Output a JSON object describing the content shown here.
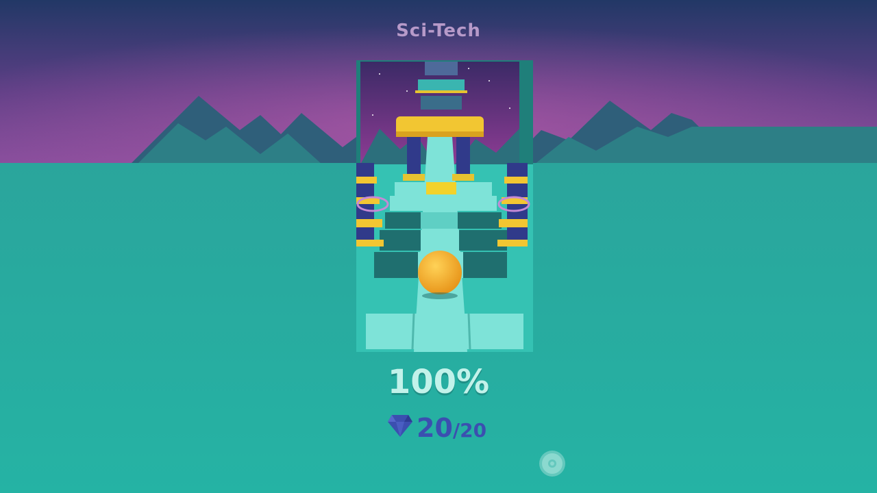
{
  "level": {
    "title": "Sci-Tech"
  },
  "result": {
    "progress": "100%",
    "gems_collected": "20",
    "gems_separator": "/",
    "gems_total": "20"
  },
  "icons": {
    "gem": "diamond-icon",
    "disc": "disc-icon"
  },
  "colors": {
    "sky_top": "#243a66",
    "sky_glow": "#8a4f9e",
    "ground": "#26b3a4",
    "mountains": "#2c6f7c",
    "title": "#b79ac9",
    "progress": "#c2f2ea",
    "gems": "#3b4fb0",
    "ball": "#f5a623",
    "tile": "#7ee3d8",
    "pillar_gold": "#f2c632"
  }
}
